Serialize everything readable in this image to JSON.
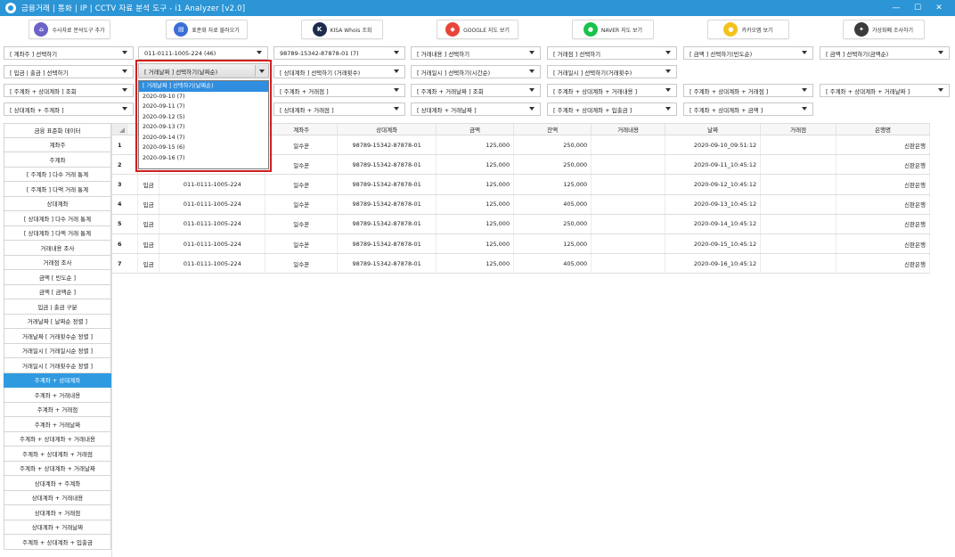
{
  "window": {
    "title": "금융거래 | 통화 | IP | CCTV 자료 분석 도구 - i1 Analyzer [v2.0]",
    "controls": [
      "—",
      "☐",
      "✕"
    ]
  },
  "toolbar": [
    {
      "label": "수사자료 분석도구 추가",
      "icon": "bank-building-icon",
      "color": "#6b63c7"
    },
    {
      "label": "표준화 자료 불러오기",
      "icon": "folder-database-icon",
      "color": "#3a6fd6"
    },
    {
      "label": "KISA Whois 조회",
      "icon": "kisa-logo-icon",
      "color": "#1d2b4f"
    },
    {
      "label": "GOOGLE 지도 보기",
      "icon": "google-maps-icon",
      "color": "#e8443a"
    },
    {
      "label": "NAVER 지도 보기",
      "icon": "naver-map-pin-icon",
      "color": "#19c24b"
    },
    {
      "label": "카카오맵 보기",
      "icon": "kakao-map-pin-icon",
      "color": "#f5c21b"
    },
    {
      "label": "가상화폐 조사하기",
      "icon": "crypto-coin-icon",
      "color": "#3b3b3b"
    }
  ],
  "filters": {
    "row1": [
      "[ 계좌주 ] 선택하기",
      "011-0111-1005-224 (46)",
      "98789-15342-87878-01 (7)",
      "[ 거래내용 ] 선택하기",
      "[ 거래점 ] 선택하기",
      "[ 금액 ] 선택하기(빈도순)",
      "[ 금액 ] 선택하기(금액순)"
    ],
    "row2": [
      "[ 입금 | 출금 ] 선택하기",
      "[ 거래날짜 ] 선택하기(날짜순)",
      "[ 상대계좌 ] 선택하기 (거래횟수)",
      "[ 거래일시 ] 선택하기(시간순)",
      "[ 거래일시 ] 선택하기(거래횟수)"
    ],
    "row3": [
      "[ 주계좌 + 상대계좌 ] 조회",
      "[ 주계좌 + 거래점 ]",
      "[ 주계좌 + 거래날짜 ] 조회",
      "[ 주계좌 + 상대계좌 + 거래내용 ]",
      "[ 주계좌 + 상대계좌 + 거래점 ]",
      "[ 주계좌 + 상대계좌 + 거래날짜 ]"
    ],
    "row4": [
      "[ 상대계좌 + 주계좌 ]",
      "[ 상대계좌 + 거래점 ]",
      "[ 상대계좌 + 거래날짜 ]",
      "[ 주계좌 + 상대계좌 + 입출금 ]",
      "[ 주계좌 + 상대계좌 + 금액 ]"
    ]
  },
  "date_dropdown": {
    "selected": "[ 거래날짜 ] 선택하기(날짜순)",
    "options": [
      "[ 거래날짜 ] 선택하기(날짜순)",
      "2020-09-10 (7)",
      "2020-09-11 (7)",
      "2020-09-12 (5)",
      "2020-09-13 (7)",
      "2020-09-14 (7)",
      "2020-09-15 (6)",
      "2020-09-16 (7)"
    ]
  },
  "sidebar": {
    "items": [
      "금융 표준화 데이터",
      "계좌주",
      "주계좌",
      "[ 주계좌 ] 다수 거래 통계",
      "[ 주계좌 ] 다액 거래 통계",
      "상대계좌",
      "[ 상대계좌 ] 다수 거래 통계",
      "[ 상대계좌 ] 다액 거래 통계",
      "거래내용 조사",
      "거래점 조사",
      "금액 [ 빈도순 ]",
      "금액 [ 금액순 ]",
      "입금 | 출금 구분",
      "거래날짜 [ 날짜순 정렬 ]",
      "거래날짜 [ 거래횟수순 정렬 ]",
      "거래일시 [ 거래일시순 정렬 ]",
      "거래일시 [ 거래횟수순 정렬 ]",
      "주계좌 + 상대계좌",
      "주계좌 + 거래내용",
      "주계좌 + 거래점",
      "주계좌 + 거래날짜",
      "주계좌 + 상대계좌 + 거래내용",
      "주계좌 + 상대계좌 + 거래점",
      "주계좌 + 상대계좌 + 거래날짜",
      "상대계좌 + 주계좌",
      "상대계좌 + 거래내용",
      "상대계좌 + 거래점",
      "상대계좌 + 거래날짜",
      "주계좌 + 상대계좌 + 입출금"
    ],
    "active_index": 17
  },
  "grid": {
    "columns": [
      "",
      "",
      "",
      "계좌주",
      "상대계좌",
      "금액",
      "잔액",
      "거래내용",
      "날짜",
      "거래점",
      "은행명"
    ],
    "rows": [
      [
        "1",
        "",
        "",
        "일수꾼",
        "98789-15342-87878-01",
        "125,000",
        "250,000",
        "",
        "2020-09-10_09:51:12",
        "",
        "신판은행"
      ],
      [
        "2",
        "",
        "",
        "일수꾼",
        "98789-15342-87878-01",
        "125,000",
        "250,000",
        "",
        "2020-09-11_10:45:12",
        "",
        "신판은행"
      ],
      [
        "3",
        "입금",
        "011-0111-1005-224",
        "일수꾼",
        "98789-15342-87878-01",
        "125,000",
        "125,000",
        "",
        "2020-09-12_10:45:12",
        "",
        "신판은행"
      ],
      [
        "4",
        "입금",
        "011-0111-1005-224",
        "일수꾼",
        "98789-15342-87878-01",
        "125,000",
        "405,000",
        "",
        "2020-09-13_10:45:12",
        "",
        "신판은행"
      ],
      [
        "5",
        "입금",
        "011-0111-1005-224",
        "일수꾼",
        "98789-15342-87878-01",
        "125,000",
        "250,000",
        "",
        "2020-09-14_10:45:12",
        "",
        "신판은행"
      ],
      [
        "6",
        "입금",
        "011-0111-1005-224",
        "일수꾼",
        "98789-15342-87878-01",
        "125,000",
        "125,000",
        "",
        "2020-09-15_10:45:12",
        "",
        "신판은행"
      ],
      [
        "7",
        "입금",
        "011-0111-1005-224",
        "일수꾼",
        "98789-15342-87878-01",
        "125,000",
        "405,000",
        "",
        "2020-09-16_10:45:12",
        "",
        "신판은행"
      ]
    ]
  },
  "colors": {
    "titlebar": "#2b95d6",
    "active_sidebar": "#2f9ae0",
    "highlight": "#d11f1f"
  }
}
